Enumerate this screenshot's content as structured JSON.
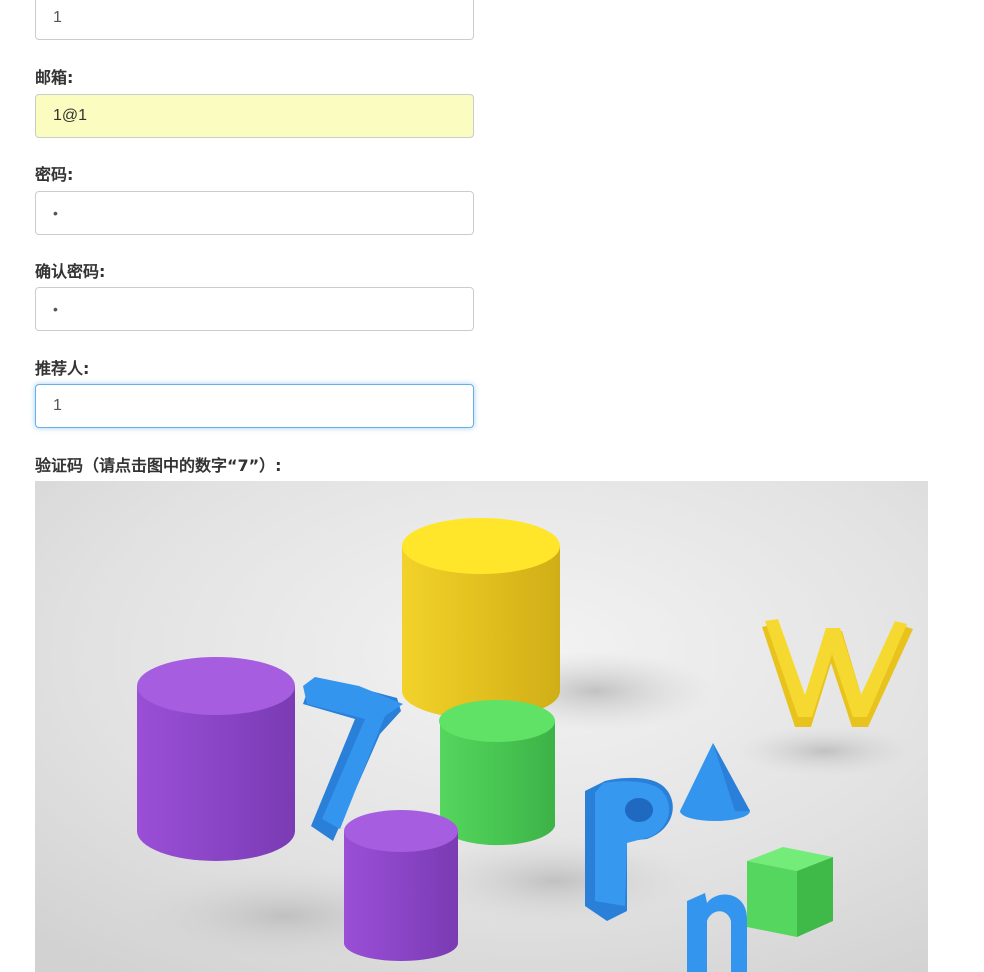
{
  "form": {
    "username_value": "1",
    "email_label": "邮箱:",
    "email_value": "1@1",
    "password_label": "密码:",
    "password_value": "•",
    "confirm_label": "确认密码:",
    "confirm_value": "•",
    "referrer_label": "推荐人:",
    "referrer_value": "1",
    "captcha_label": "验证码（请点击图中的数字“7”）:"
  },
  "captcha": {
    "digit": "7",
    "letter_w": "W",
    "letter_p": "P",
    "letter_n": "n",
    "colors": {
      "blue": "#2f8ee8",
      "yellow": "#f2d22a",
      "green": "#55d65e",
      "purple": "#9a4fd6",
      "background": "#e4e4e4"
    }
  }
}
